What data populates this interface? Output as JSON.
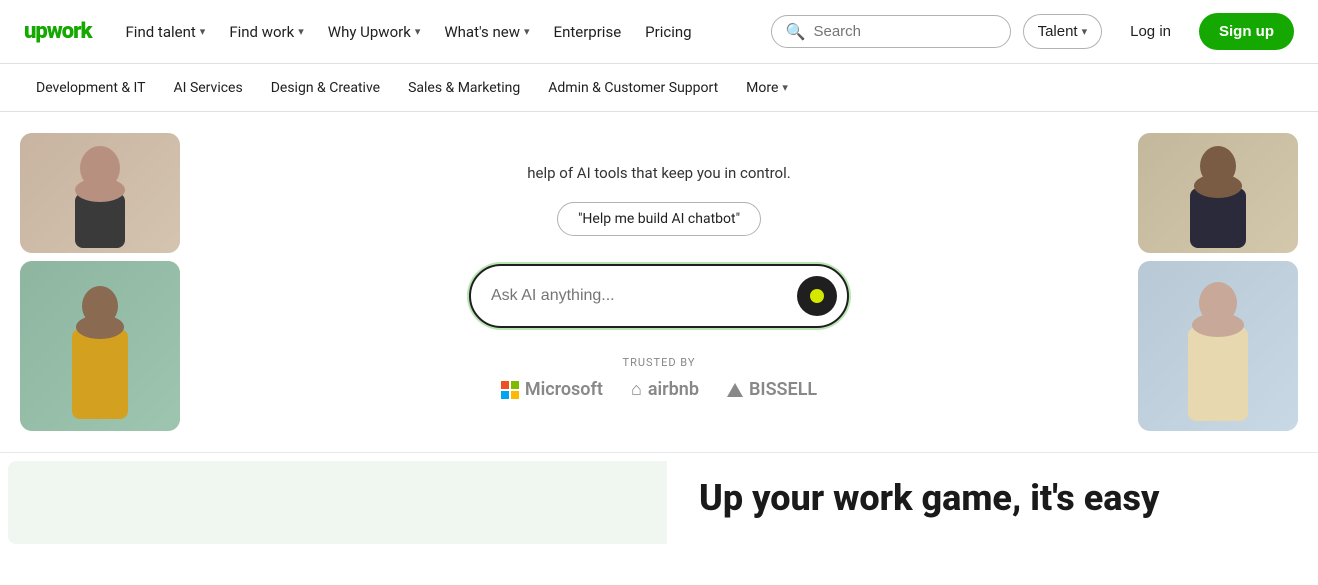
{
  "logo": {
    "text": "upwork"
  },
  "topnav": {
    "items": [
      {
        "label": "Find talent",
        "hasDropdown": true
      },
      {
        "label": "Find work",
        "hasDropdown": true
      },
      {
        "label": "Why Upwork",
        "hasDropdown": true
      },
      {
        "label": "What's new",
        "hasDropdown": true
      },
      {
        "label": "Enterprise",
        "hasDropdown": false
      }
    ],
    "pricing": "Pricing",
    "search": {
      "placeholder": "Search",
      "talent_dropdown": "Talent"
    },
    "login": "Log in",
    "signup": "Sign up"
  },
  "secondarynav": {
    "items": [
      "Development & IT",
      "AI Services",
      "Design & Creative",
      "Sales & Marketing",
      "Admin & Customer Support"
    ],
    "more": "More"
  },
  "hero": {
    "subtitle": "help of AI tools that keep you in control.",
    "suggestion_pill": "\"Help me build AI chatbot\"",
    "ai_input_placeholder": "Ask AI anything...",
    "trusted_label": "TRUSTED BY",
    "trusted_logos": [
      {
        "name": "Microsoft",
        "type": "microsoft"
      },
      {
        "name": "airbnb",
        "type": "airbnb"
      },
      {
        "name": "BISSELL",
        "type": "bissell"
      }
    ]
  },
  "bottom": {
    "heading": "Up your work game, it's easy"
  }
}
